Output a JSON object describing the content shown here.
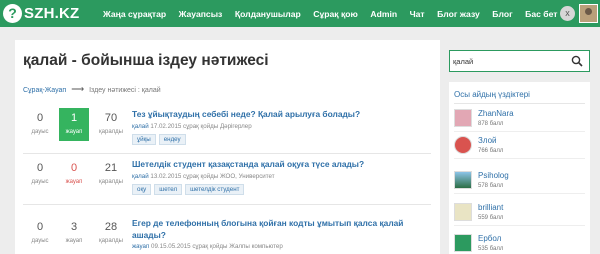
{
  "header": {
    "logo_mark": "?",
    "logo_text": "SZH.KZ",
    "nav": [
      "Жаңа сұрақтар",
      "Жауапсыз",
      "Қолданушылар",
      "Сұрақ қою",
      "Admin",
      "Чат",
      "Блог жазу",
      "Блог",
      "Бас бет"
    ],
    "close_label": "x"
  },
  "page": {
    "title": "қалай - бойынша іздеу нәтижесі",
    "breadcrumb": {
      "home": "Сұрақ-Жауап",
      "arrow": "⟶",
      "current": "Іздеу нәтижесі : қалай"
    }
  },
  "questions": [
    {
      "votes": "0",
      "votes_label": "дауыс",
      "answers": "1",
      "answers_label": "жауап",
      "views": "70",
      "views_label": "қаралды",
      "title": "Тез ұйықтаудың себебі неде? Қалай арылуға болады?",
      "meta_link": "қалай",
      "meta_text": " 17.02.2015 сұрақ қойды Дәрігерлер",
      "tags": [
        "ұйқы",
        "ендеу"
      ]
    },
    {
      "votes": "0",
      "votes_label": "дауыс",
      "answers": "0",
      "answers_label": "жауап",
      "views": "21",
      "views_label": "қаралды",
      "title": "Шетелдік студент қазақстанда қалай оқуға түсе алады?",
      "meta_link": "қалай",
      "meta_text": " 13.02.2015 сұрақ қойды ЖОО, Университет",
      "tags": [
        "оқу",
        "шетел",
        "шетелдік студент"
      ]
    },
    {
      "votes": "0",
      "votes_label": "дауыс",
      "answers": "3",
      "answers_label": "жауап",
      "views": "28",
      "views_label": "қаралды",
      "title": "Егер де телефонның блогына қойған кодты ұмытып қалса қалай ашады?",
      "meta_link": "жауап",
      "meta_text": " 09.15.05.2015 сұрақ қойды Жалпы компьютер",
      "tags": []
    }
  ],
  "search": {
    "value": "қалай",
    "placeholder": ""
  },
  "sidebar": {
    "heading": "Осы айдың үздіктері",
    "users": [
      {
        "name": "ZhanNara",
        "points": "878 балл",
        "avatar_color": "#e2a7b4"
      },
      {
        "name": "Злой",
        "points": "766 балл",
        "avatar_color": "#d9534f"
      },
      {
        "name": "Psiholog",
        "points": "578 балл",
        "avatar_color": "#4a90c2"
      },
      {
        "name": "brilliant",
        "points": "559 балл",
        "avatar_color": "#c9c39a"
      },
      {
        "name": "Ербол",
        "points": "535 балл",
        "avatar_color": "#2c9a5f"
      }
    ]
  },
  "colors": {
    "brand": "#2c9a5f",
    "link": "#2f70a8",
    "answered": "#35b45f",
    "unanswered": "#d9534f"
  }
}
